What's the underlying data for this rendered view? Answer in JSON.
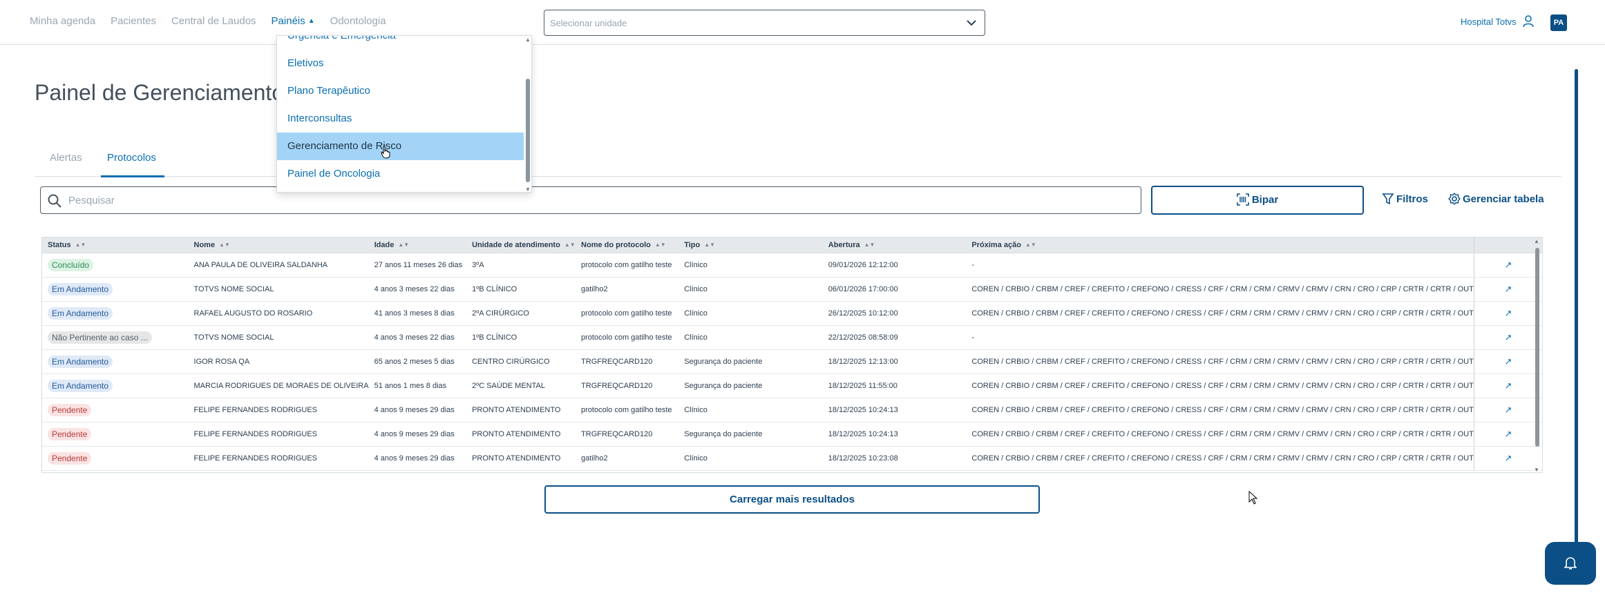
{
  "nav": {
    "items": [
      {
        "label": "Minha agenda",
        "active": false
      },
      {
        "label": "Pacientes",
        "active": false
      },
      {
        "label": "Central de Laudos",
        "active": false
      },
      {
        "label": "Painéis",
        "active": true
      },
      {
        "label": "Odontologia",
        "active": false
      }
    ],
    "unit_select_placeholder": "Selecionar unidade",
    "hospital": "Hospital Totvs",
    "avatar_initials": "PA"
  },
  "dropdown": {
    "items": [
      {
        "label": "Urgência e Emergência",
        "selected": false
      },
      {
        "label": "Eletivos",
        "selected": false
      },
      {
        "label": "Plano Terapêutico",
        "selected": false
      },
      {
        "label": "Interconsultas",
        "selected": false
      },
      {
        "label": "Gerenciamento de Risco",
        "selected": true
      },
      {
        "label": "Painel de Oncologia",
        "selected": false
      }
    ]
  },
  "page": {
    "title": "Painel de Gerenciamento de Risco",
    "tabs": [
      "Alertas",
      "Protocolos"
    ],
    "active_tab": "Protocolos",
    "search_placeholder": "Pesquisar",
    "bipar_label": "Bipar",
    "filtros_label": "Filtros",
    "gerenciar_label": "Gerenciar tabela",
    "load_more_label": "Carregar mais resultados"
  },
  "table": {
    "columns": [
      "Status",
      "Nome",
      "Idade",
      "Unidade de atendimento",
      "Nome do protocolo",
      "Tipo",
      "Abertura",
      "Próxima ação"
    ],
    "rows": [
      {
        "status": "Concluído",
        "status_type": "concluido",
        "nome": "ANA PAULA DE OLIVEIRA SALDANHA",
        "idade": "27 anos 11 meses 26 dias",
        "unidade": "3ºA",
        "protocolo": "protocolo com gatilho teste",
        "tipo": "Clínico",
        "abertura": "09/01/2026 12:12:00",
        "proxima": "-"
      },
      {
        "status": "Em Andamento",
        "status_type": "andamento",
        "nome": "TOTVS NOME SOCIAL",
        "idade": "4 anos 3 meses 22 dias",
        "unidade": "1ºB CLÍNICO",
        "protocolo": "gatilho2",
        "tipo": "Clínico",
        "abertura": "06/01/2026 17:00:00",
        "proxima": "COREN / CRBIO / CRBM / CREF / CREFITO / CREFONO / CRESS / CRF / CRM / CRM / CRMV / CRMV / CRN / CRO / CRP / CRTR / CRTR / OUT"
      },
      {
        "status": "Em Andamento",
        "status_type": "andamento",
        "nome": "RAFAEL AUGUSTO DO ROSARIO",
        "idade": "41 anos 3 meses 8 dias",
        "unidade": "2ºA CIRÚRGICO",
        "protocolo": "protocolo com gatilho teste",
        "tipo": "Clínico",
        "abertura": "26/12/2025 10:12:00",
        "proxima": "COREN / CRBIO / CRBM / CREF / CREFITO / CREFONO / CRESS / CRF / CRM / CRM / CRMV / CRMV / CRN / CRO / CRP / CRTR / CRTR / OUT"
      },
      {
        "status": "Não Pertinente ao caso ...",
        "status_type": "nao",
        "nome": "TOTVS NOME SOCIAL",
        "idade": "4 anos 3 meses 22 dias",
        "unidade": "1ºB CLÍNICO",
        "protocolo": "protocolo com gatilho teste",
        "tipo": "Clínico",
        "abertura": "22/12/2025 08:58:09",
        "proxima": "-"
      },
      {
        "status": "Em Andamento",
        "status_type": "andamento",
        "nome": "IGOR ROSA QA",
        "idade": "65 anos 2 meses 5 dias",
        "unidade": "CENTRO CIRÚRGICO",
        "protocolo": "TRGFREQCARD120",
        "tipo": "Segurança do paciente",
        "abertura": "18/12/2025 12:13:00",
        "proxima": "COREN / CRBIO / CRBM / CREF / CREFITO / CREFONO / CRESS / CRF / CRM / CRM / CRMV / CRMV / CRN / CRO / CRP / CRTR / CRTR / OUT"
      },
      {
        "status": "Em Andamento",
        "status_type": "andamento",
        "nome": "MARCIA RODRIGUES DE MORAES DE OLIVEIRA",
        "idade": "51 anos 1 mes 8 dias",
        "unidade": "2ºC SAÚDE MENTAL",
        "protocolo": "TRGFREQCARD120",
        "tipo": "Segurança do paciente",
        "abertura": "18/12/2025 11:55:00",
        "proxima": "COREN / CRBIO / CRBM / CREF / CREFITO / CREFONO / CRESS / CRF / CRM / CRM / CRMV / CRMV / CRN / CRO / CRP / CRTR / CRTR / OUT"
      },
      {
        "status": "Pendente",
        "status_type": "pendente",
        "nome": "FELIPE FERNANDES RODRIGUES",
        "idade": "4 anos 9 meses 29 dias",
        "unidade": "PRONTO ATENDIMENTO",
        "protocolo": "protocolo com gatilho teste",
        "tipo": "Clínico",
        "abertura": "18/12/2025 10:24:13",
        "proxima": "COREN / CRBIO / CRBM / CREF / CREFITO / CREFONO / CRESS / CRF / CRM / CRM / CRMV / CRMV / CRN / CRO / CRP / CRTR / CRTR / OUT"
      },
      {
        "status": "Pendente",
        "status_type": "pendente",
        "nome": "FELIPE FERNANDES RODRIGUES",
        "idade": "4 anos 9 meses 29 dias",
        "unidade": "PRONTO ATENDIMENTO",
        "protocolo": "TRGFREQCARD120",
        "tipo": "Segurança do paciente",
        "abertura": "18/12/2025 10:24:13",
        "proxima": "COREN / CRBIO / CRBM / CREF / CREFITO / CREFONO / CRESS / CRF / CRM / CRM / CRMV / CRMV / CRN / CRO / CRP / CRTR / CRTR / OUT"
      },
      {
        "status": "Pendente",
        "status_type": "pendente",
        "nome": "FELIPE FERNANDES RODRIGUES",
        "idade": "4 anos 9 meses 29 dias",
        "unidade": "PRONTO ATENDIMENTO",
        "protocolo": "gatilho2",
        "tipo": "Clínico",
        "abertura": "18/12/2025 10:23:08",
        "proxima": "COREN / CRBIO / CRBM / CREF / CREFITO / CREFONO / CRESS / CRF / CRM / CRM / CRMV / CRMV / CRN / CRO / CRP / CRTR / CRTR / OUT"
      }
    ]
  },
  "icons": {
    "sort": "sort-icon",
    "open_row": "arrow-up-right-icon",
    "bell": "bell-icon",
    "user": "user-icon",
    "search": "search-icon",
    "filter": "filter-icon",
    "settings": "gear-icon",
    "barcode": "barcode-icon"
  },
  "colors": {
    "primary": "#0b4f86",
    "link": "#0b6fb3",
    "selected_item_bg": "#a3d4f7",
    "concluido_bg": "#dcf3e3",
    "andamento_bg": "#dfe9f7",
    "nao_bg": "#e6e6e6",
    "pendente_bg": "#fbe3e3"
  }
}
